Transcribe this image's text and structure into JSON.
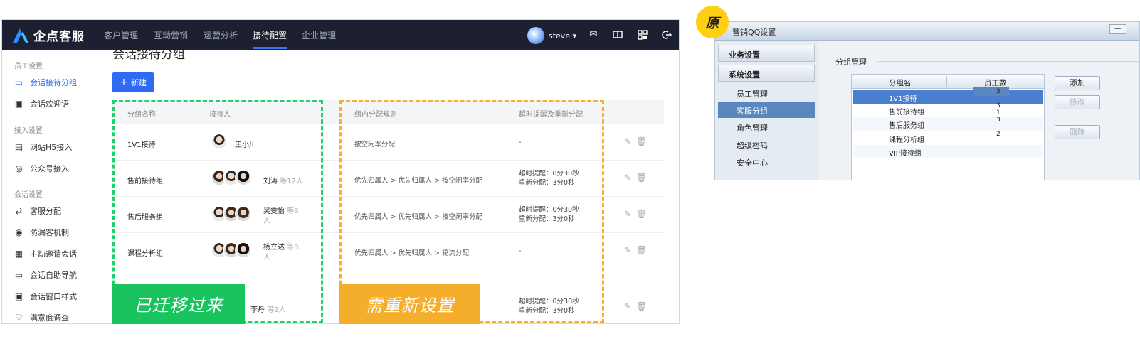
{
  "app": {
    "brand": "企点客服",
    "nav": [
      "客户管理",
      "互动营销",
      "运营分析",
      "接待配置",
      "企业管理"
    ],
    "nav_active": "接待配置",
    "user": "steve ▾"
  },
  "sidebar": {
    "groups": [
      {
        "title": "员工设置",
        "items": [
          {
            "label": "会话接待分组",
            "icon": "chat-group-icon"
          },
          {
            "label": "会话欢迎语",
            "icon": "welcome-icon"
          }
        ]
      },
      {
        "title": "接入设置",
        "items": [
          {
            "label": "网站H5接入",
            "icon": "web-icon"
          },
          {
            "label": "公众号接入",
            "icon": "wechat-icon"
          }
        ]
      },
      {
        "title": "会话设置",
        "items": [
          {
            "label": "客服分配",
            "icon": "dispatch-icon"
          },
          {
            "label": "防漏客机制",
            "icon": "guard-icon"
          },
          {
            "label": "主动邀请会话",
            "icon": "invite-icon"
          },
          {
            "label": "会话自助导航",
            "icon": "nav-icon"
          },
          {
            "label": "会话窗口样式",
            "icon": "window-icon"
          },
          {
            "label": "满意度调查",
            "icon": "survey-icon"
          }
        ]
      }
    ],
    "active": "会话接待分组"
  },
  "page": {
    "title": "会话接待分组",
    "new_button": "新建",
    "columns": [
      "分组名称",
      "接待人",
      "组内分配规则",
      "超时提醒及重新分配"
    ],
    "rows": [
      {
        "name": "1V1接待",
        "agent": "王小川",
        "more": "",
        "rule": "按空闲率分配",
        "timeout1": "-",
        "timeout2": ""
      },
      {
        "name": "售前接待组",
        "agent": "刘涛",
        "more": "等12人",
        "rule": "优先归属人 > 优先归属人 > 按空闲率分配",
        "timeout1": "超时提醒：0分30秒",
        "timeout2": "重新分配：3分0秒"
      },
      {
        "name": "售后服务组",
        "agent": "吴雯怡",
        "more": "等8人",
        "rule": "优先归属人 > 优先归属人 > 按空闲率分配",
        "timeout1": "超时提醒：0分30秒",
        "timeout2": "重新分配：3分0秒"
      },
      {
        "name": "课程分析组",
        "agent": "杨立达",
        "more": "等8人",
        "rule": "优先归属人 > 优先归属人 > 轮流分配",
        "timeout1": "-",
        "timeout2": ""
      },
      {
        "name": "",
        "agent": "李丹",
        "more": "等2人",
        "rule": "",
        "timeout1": "超时提醒：0分30秒",
        "timeout2": "重新分配：3分0秒"
      }
    ]
  },
  "annotations": {
    "migrated": "已迁移过来",
    "reset": "需重新设置",
    "original_badge": "原"
  },
  "legacy": {
    "title": "营销QQ设置",
    "minimize": "—",
    "sections": [
      "业务设置",
      "系统设置"
    ],
    "items": [
      "员工管理",
      "客服分组",
      "角色管理",
      "超级密码",
      "安全中心"
    ],
    "selected_item": "客服分组",
    "section_title": "分组管理",
    "columns": [
      "分组名",
      "员工数"
    ],
    "rows": [
      "1V1接待",
      "售前接待组",
      "售后服务组",
      "课程分析组",
      "VIP接待组"
    ],
    "counts": [
      "3",
      "3",
      "1",
      "3",
      "2"
    ],
    "buttons": [
      "添加",
      "修改",
      "删除"
    ]
  },
  "colors": {
    "accent": "#2f6bf2",
    "topbar": "#1c2030",
    "green": "#19c45f",
    "orange": "#f5ae2c",
    "badge": "#ffcf14"
  }
}
